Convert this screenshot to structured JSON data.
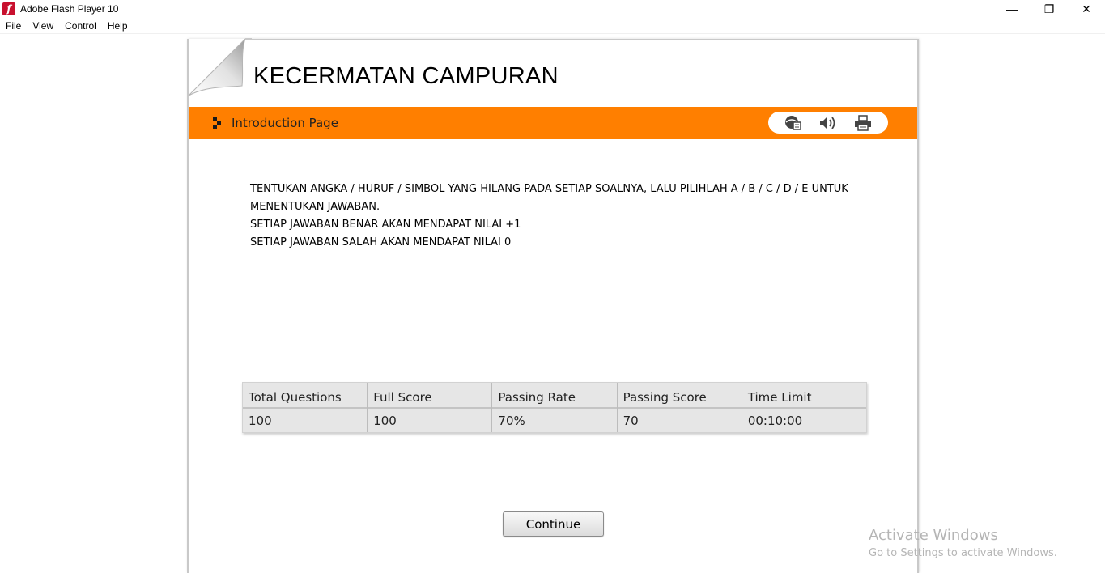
{
  "window": {
    "title": "Adobe Flash Player 10",
    "icon_glyph": "f",
    "controls": {
      "minimize": "—",
      "restore": "❐",
      "close": "✕"
    }
  },
  "menu": [
    "File",
    "View",
    "Control",
    "Help"
  ],
  "page": {
    "title": "KECERMATAN CAMPURAN",
    "section_label": "Introduction Page",
    "accent_color": "#ff7f00",
    "tool_icons": [
      "help-icon",
      "speaker-icon",
      "printer-icon"
    ]
  },
  "instructions": [
    "TENTUKAN ANGKA / HURUF / SIMBOL YANG HILANG PADA SETIAP SOALNYA, LALU PILIHLAH A / B / C / D / E UNTUK MENENTUKAN JAWABAN.",
    "SETIAP JAWABAN BENAR AKAN MENDAPAT NILAI +1",
    "SETIAP JAWABAN SALAH AKAN MENDAPAT NILAI 0"
  ],
  "info_table": {
    "headers": [
      "Total Questions",
      "Full Score",
      "Passing Rate",
      "Passing Score",
      "Time Limit"
    ],
    "values": [
      "100",
      "100",
      "70%",
      "70",
      "00:10:00"
    ]
  },
  "continue_label": "Continue",
  "watermark": {
    "line1": "Activate Windows",
    "line2": "Go to Settings to activate Windows."
  }
}
